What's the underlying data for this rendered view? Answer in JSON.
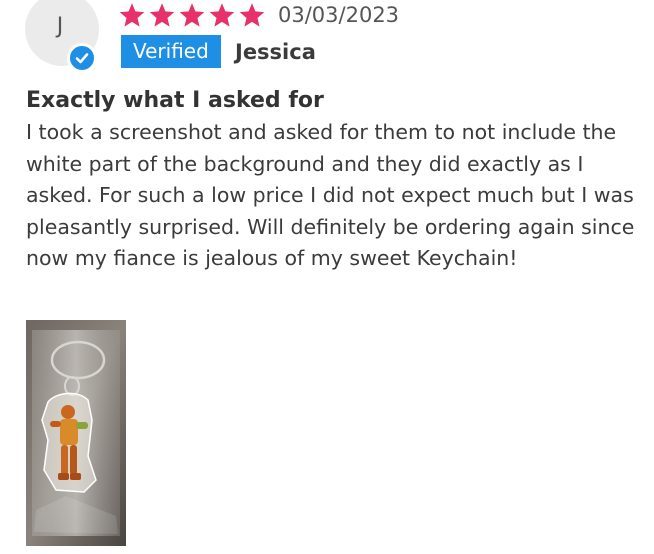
{
  "reviewer": {
    "initial": "J",
    "name": "Jessica",
    "verified_label": "Verified"
  },
  "rating": {
    "stars": 5,
    "max": 5,
    "color": "#e8306a"
  },
  "date": "03/03/2023",
  "review": {
    "title": "Exactly what I asked for",
    "body": "I took a screenshot and asked for them to not include the white part of the background and they did exactly as I asked. For such a low price I did not expect much but I was pleasantly surprised. Will definitely be ordering again since now my fiance is jealous of my sweet Keychain!"
  },
  "photo": {
    "icon": "review-photo-thumbnail"
  },
  "colors": {
    "accent": "#1f8fe6",
    "star": "#e8306a",
    "avatar_bg": "#ebebeb",
    "text": "#3b3b3b"
  }
}
